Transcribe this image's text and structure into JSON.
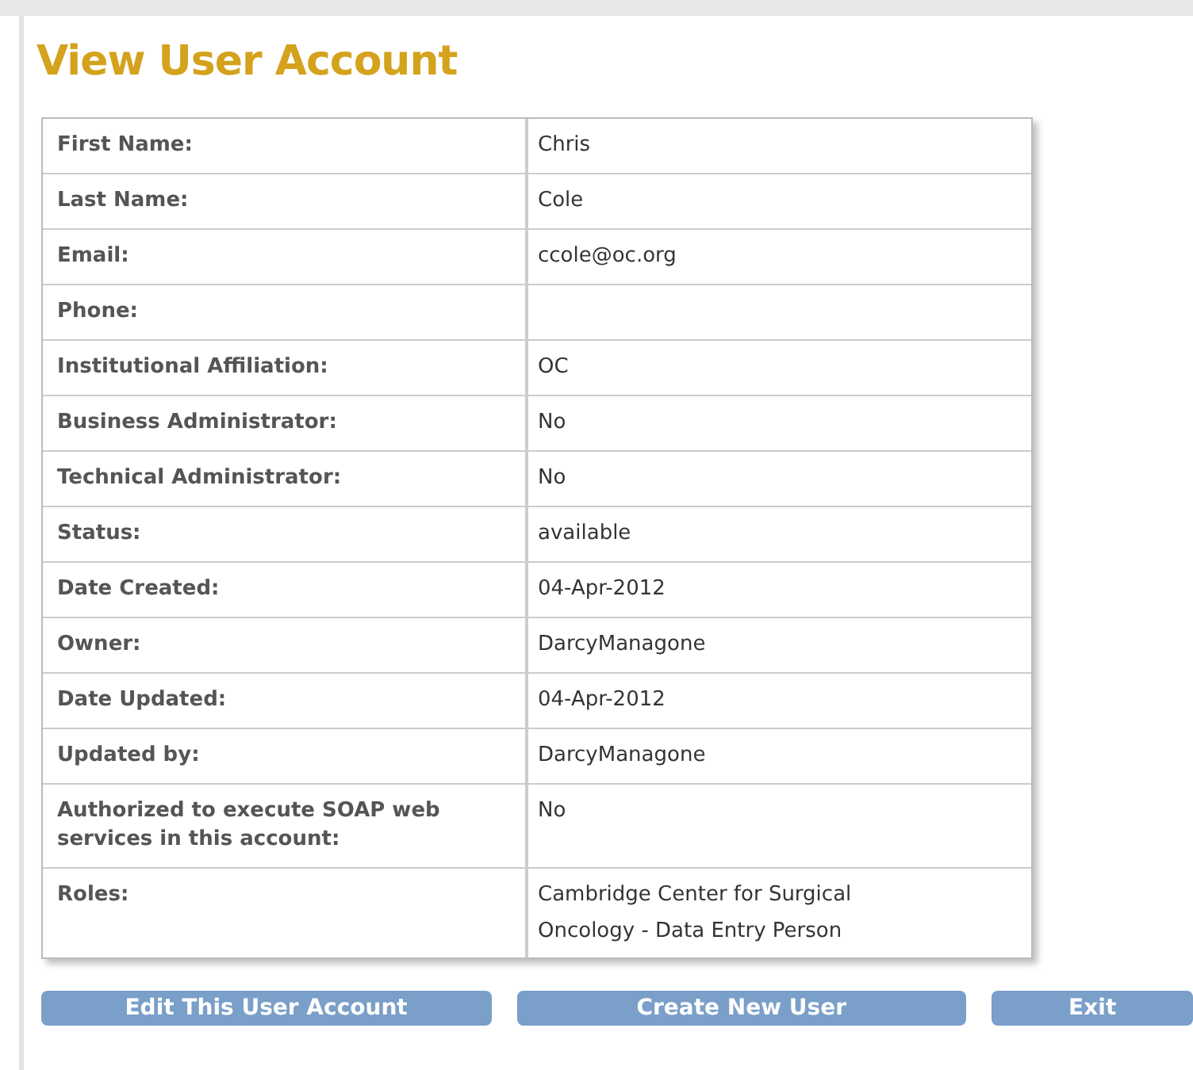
{
  "title": "View User Account",
  "fields": [
    {
      "label": "First Name:",
      "value": "Chris"
    },
    {
      "label": "Last Name:",
      "value": "Cole"
    },
    {
      "label": "Email:",
      "value": "ccole@oc.org"
    },
    {
      "label": "Phone:"
    },
    {
      "label": "Institutional Affiliation:",
      "value": "OC"
    },
    {
      "label": "Business Administrator:",
      "value": "No"
    },
    {
      "label": "Technical Administrator:",
      "value": "No"
    },
    {
      "label": "Status:",
      "value": "available"
    },
    {
      "label": "Date Created:",
      "value": "04-Apr-2012"
    },
    {
      "label": "Owner:",
      "value": "DarcyManagone"
    },
    {
      "label": "Date Updated:",
      "value": "04-Apr-2012"
    },
    {
      "label": "Updated by:",
      "value": "DarcyManagone"
    },
    {
      "label": "Authorized to execute SOAP web services in this account:",
      "value": "No"
    },
    {
      "label": "Roles:",
      "value": "Cambridge Center for Surgical Oncology - Data Entry Person"
    }
  ],
  "buttons": [
    "Edit This User Account",
    "Create New User",
    "Exit"
  ]
}
